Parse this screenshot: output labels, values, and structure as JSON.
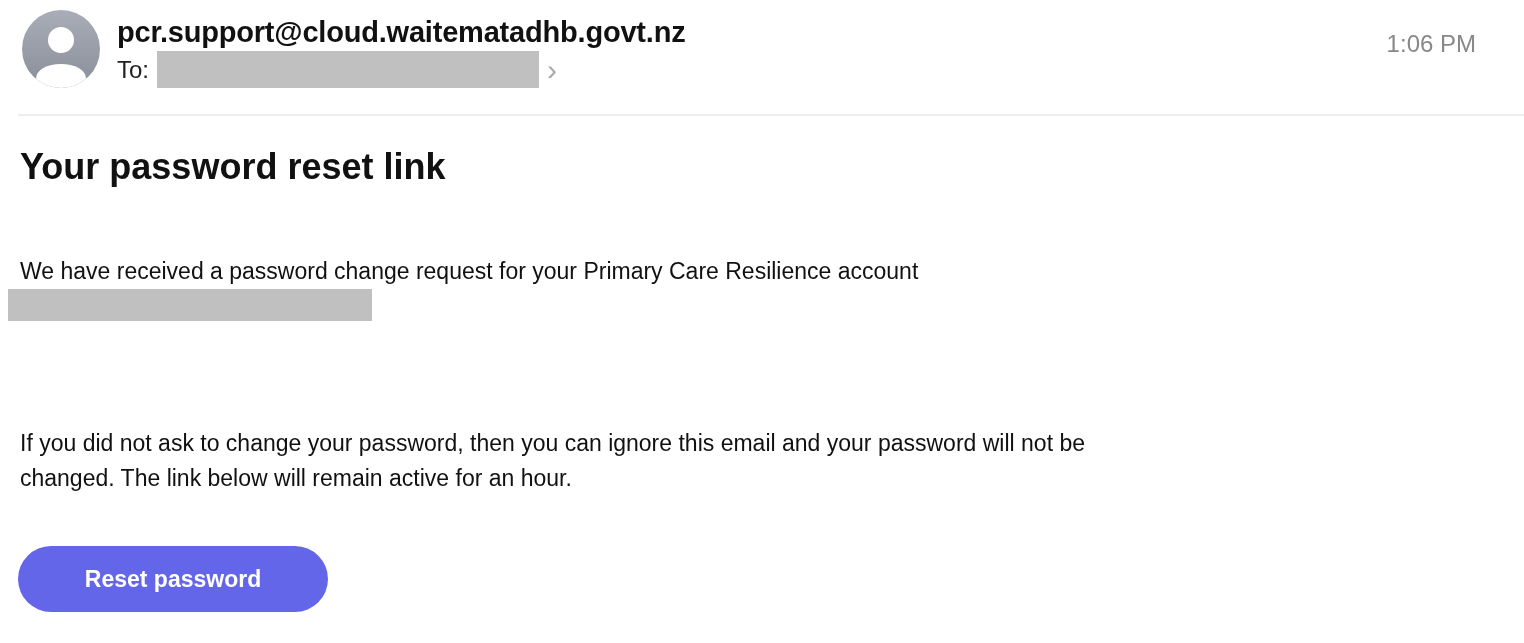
{
  "header": {
    "sender": "pcr.support@cloud.waitematadhb.govt.nz",
    "to_label": "To:",
    "chevron": "›",
    "time": "1:06 PM"
  },
  "subject": "Your password reset link",
  "body": {
    "paragraphs": [
      "We have received a password change request for your Primary Care Resilience account",
      "If you did not ask to change your password, then you can ignore this email and your password will not be changed. The link below will remain active for an hour."
    ]
  },
  "button": {
    "label": "Reset password"
  }
}
